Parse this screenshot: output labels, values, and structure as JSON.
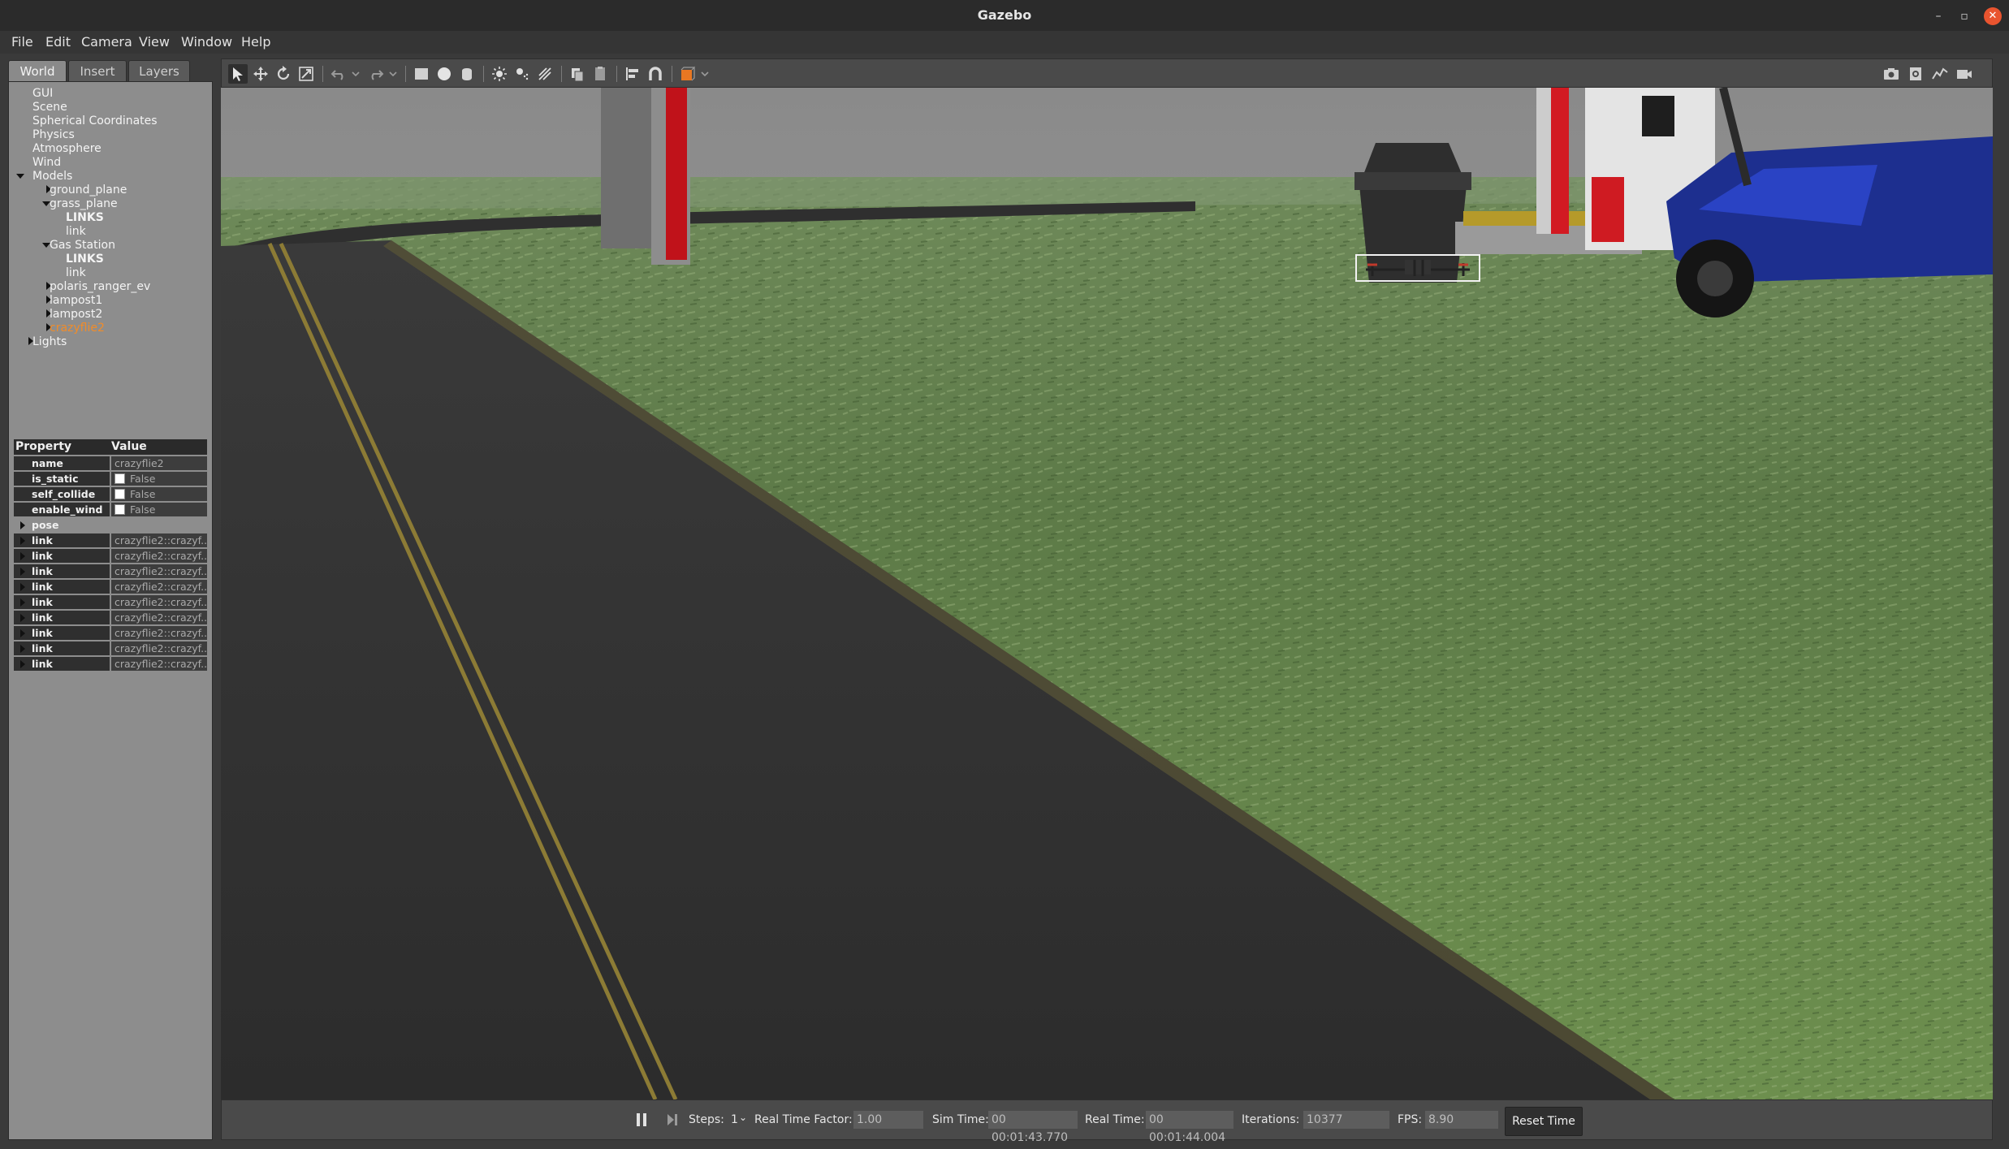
{
  "window": {
    "title": "Gazebo",
    "minimize": "–",
    "maximize": "▫",
    "close": "✕"
  },
  "menu": [
    "File",
    "Edit",
    "Camera",
    "View",
    "Window",
    "Help"
  ],
  "tabs": [
    "World",
    "Insert",
    "Layers"
  ],
  "tree": {
    "gui": "GUI",
    "scene": "Scene",
    "spherical": "Spherical Coordinates",
    "physics": "Physics",
    "atmosphere": "Atmosphere",
    "wind": "Wind",
    "models": "Models",
    "ground_plane": "ground_plane",
    "grass_plane": "grass_plane",
    "links1": "LINKS",
    "link1": "link",
    "gas_station": "Gas Station",
    "links2": "LINKS",
    "link2": "link",
    "polaris": "polaris_ranger_ev",
    "lampost1": "lampost1",
    "lampost2": "lampost2",
    "crazyflie2": "crazyflie2",
    "lights": "Lights"
  },
  "properties": {
    "header_property": "Property",
    "header_value": "Value",
    "rows": [
      {
        "name": "name",
        "value": "crazyflie2"
      },
      {
        "name": "is_static",
        "value": "False"
      },
      {
        "name": "self_collide",
        "value": "False"
      },
      {
        "name": "enable_wind",
        "value": "False"
      },
      {
        "name": "pose",
        "value": ""
      },
      {
        "name": "link",
        "value": "crazyflie2::crazyf..."
      },
      {
        "name": "link",
        "value": "crazyflie2::crazyf..."
      },
      {
        "name": "link",
        "value": "crazyflie2::crazyf..."
      },
      {
        "name": "link",
        "value": "crazyflie2::crazyf..."
      },
      {
        "name": "link",
        "value": "crazyflie2::crazyf..."
      },
      {
        "name": "link",
        "value": "crazyflie2::crazyf..."
      },
      {
        "name": "link",
        "value": "crazyflie2::crazyf..."
      },
      {
        "name": "link",
        "value": "crazyflie2::crazyf..."
      },
      {
        "name": "link",
        "value": "crazyflie2::crazyf..."
      }
    ]
  },
  "status": {
    "steps_label": "Steps:",
    "steps_value": "1",
    "rtf_label": "Real Time Factor:",
    "rtf_value": "1.00",
    "sim_label": "Sim Time:",
    "sim_value": "00 00:01:43.770",
    "real_label": "Real Time:",
    "real_value": "00 00:01:44.004",
    "iter_label": "Iterations:",
    "iter_value": "10377",
    "fps_label": "FPS:",
    "fps_value": "8.90",
    "reset_label": "Reset Time"
  },
  "colors": {
    "selection": "#f08c2a",
    "accent_orange": "#e87722",
    "close": "#e9542f"
  }
}
